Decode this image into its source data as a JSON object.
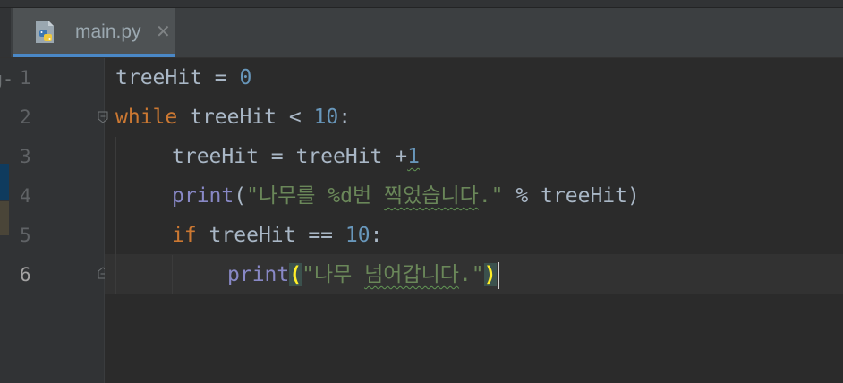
{
  "editor": {
    "tab": {
      "filename": "main.py",
      "close_glyph": "✕",
      "icon": "python-file-icon"
    },
    "gutter_cut_text": "g-",
    "line_numbers": [
      "1",
      "2",
      "3",
      "4",
      "5",
      "6"
    ],
    "current_line": 6,
    "code": {
      "l1": {
        "var": "treeHit",
        "op": " = ",
        "num": "0"
      },
      "l2": {
        "kw": "while",
        "var": " treeHit ",
        "op": "<",
        "num": " 10",
        "tail": ":"
      },
      "l3": {
        "var": "treeHit = treeHit +",
        "num": "1"
      },
      "l4": {
        "fn": "print",
        "open": "(",
        "str_a": "\"나무를 %d번 ",
        "str_typo": "찍었습니다",
        "str_b": ".\"",
        "rest": " % treeHit)"
      },
      "l5": {
        "kw": "if",
        "var": " treeHit == ",
        "num": "10",
        "tail": ":"
      },
      "l6": {
        "fn": "print",
        "open": "(",
        "str_a": "\"나무 ",
        "str_typo": "넘어갑니다",
        "str_b": ".\"",
        "close": ")"
      }
    },
    "colors": {
      "background": "#2b2b2b",
      "keyword": "#cc7832",
      "number": "#6897bb",
      "string": "#6a8759",
      "builtin": "#8888c6",
      "text": "#a9b7c6",
      "tab_accent": "#4a88c7"
    }
  }
}
